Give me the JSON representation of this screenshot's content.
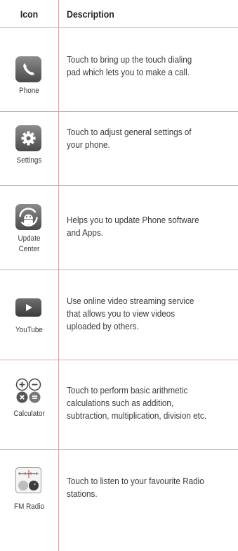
{
  "header": {
    "icon": "Icon",
    "description": "Description"
  },
  "rows": [
    {
      "icon": "phone-icon",
      "label": "Phone",
      "lines": [
        "Touch to bring up the touch dialing",
        "pad which lets you to make a call."
      ]
    },
    {
      "icon": "gear-icon",
      "label": "Settings",
      "lines": [
        "Touch to adjust general settings of",
        "your phone."
      ]
    },
    {
      "icon": "update-center-icon",
      "label_lines": [
        "Update",
        "Center"
      ],
      "lines": [
        "Helps you to update Phone software",
        "and  Apps."
      ]
    },
    {
      "icon": "youtube-icon",
      "label": "YouTube",
      "lines": [
        "Use online video streaming service",
        "that allows you to view videos",
        "uploaded by others."
      ]
    },
    {
      "icon": "calculator-icon",
      "label": "Calculator",
      "lines": [
        "Touch to perform basic arithmetic",
        "calculations such as addition,",
        "subtraction, multiplication, division etc."
      ]
    },
    {
      "icon": "fm-radio-icon",
      "label": "FM Radio",
      "lines": [
        "Touch to listen to your  favourite Radio",
        "stations."
      ]
    }
  ],
  "colors": {
    "rule": "#e0a3a5",
    "text": "#3a3a3a"
  }
}
